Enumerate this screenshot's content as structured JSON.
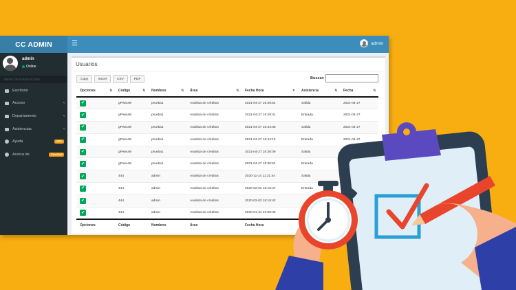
{
  "app": {
    "logo": "CC ADMIN",
    "menu_icon": "hamburger-icon",
    "user_name": "admin"
  },
  "sidebar": {
    "user": {
      "name": "admin",
      "status": "Online"
    },
    "header": "MENÚ DE NAVEGACIÓN",
    "items": [
      {
        "label": "Escritorio",
        "icon": "dashboard-icon"
      },
      {
        "label": "Acceso",
        "icon": "folder-icon"
      },
      {
        "label": "Departamento",
        "icon": "folder-icon"
      },
      {
        "label": "Asistencias",
        "icon": "folder-icon"
      },
      {
        "label": "Ayuda",
        "icon": "question-icon",
        "badge": "PDF"
      },
      {
        "label": "Acerca de",
        "icon": "info-icon",
        "badge": "ComCod"
      }
    ]
  },
  "main": {
    "title": "Usuarios",
    "buttons": [
      "Copy",
      "Excel",
      "CSV",
      "PDF"
    ],
    "search_label": "Buscar:",
    "columns": [
      "Opciones",
      "Código",
      "Nombres",
      "Área",
      "Fecha Hora",
      "Asistencia",
      "Fecha"
    ],
    "rows": [
      [
        "gPweuW",
        "prueba1",
        "Analista de créditos",
        "2021-04-27 16:49:54",
        "Salida",
        "2021-04-27"
      ],
      [
        "gPweuW",
        "prueba1",
        "Analista de créditos",
        "2021-04-27 16:49:31",
        "Entrada",
        "2021-04-27"
      ],
      [
        "gPweuW",
        "prueba1",
        "Analista de créditos",
        "2021-04-27 16:44:38",
        "Salida",
        "2021-04-27"
      ],
      [
        "gPweuW",
        "prueba1",
        "Analista de créditos",
        "2021-04-27 16:44:16",
        "Entrada",
        "2021-04-27"
      ],
      [
        "gPweuW",
        "prueba1",
        "Analista de créditos",
        "2021-04-27 16:38:09",
        "Salida",
        "2021-04-27"
      ],
      [
        "gPweuW",
        "prueba1",
        "Analista de créditos",
        "2021-04-27 16:36:54",
        "Entrada",
        ""
      ],
      [
        "444",
        "admin",
        "Analista de créditos",
        "2020-11-14 11:31:44",
        "Salida",
        ""
      ],
      [
        "444",
        "admin",
        "Analista de créditos",
        "2020-02-02 18:15:47",
        "Entrada",
        ""
      ],
      [
        "444",
        "admin",
        "Analista de créditos",
        "2020-02-02 18:15:42",
        "",
        ""
      ],
      [
        "444",
        "admin",
        "Analista de créditos",
        "2020-01-31 21:08:49",
        "",
        ""
      ]
    ],
    "footer_columns": [
      "Opciones",
      "Código",
      "Nombres",
      "Área",
      "Fecha Hora"
    ]
  },
  "colors": {
    "background": "#f8ad11",
    "topbar": "#3c8dbc",
    "sidebar": "#222d32",
    "check": "#00a65a"
  }
}
